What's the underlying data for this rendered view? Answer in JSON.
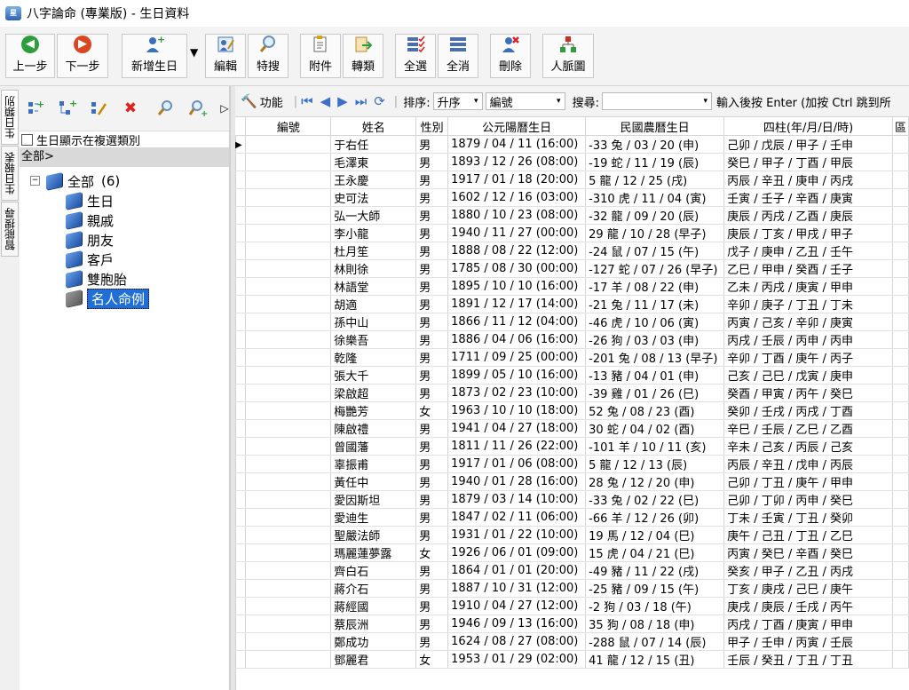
{
  "window": {
    "title": "八字論命 (專業版) - 生日資料",
    "icon_text": "星"
  },
  "toolbar": {
    "buttons": [
      {
        "label": "上一步",
        "icon": "back-arrow-icon"
      },
      {
        "label": "下一步",
        "icon": "forward-arrow-icon"
      },
      {
        "label": "新增生日",
        "icon": "add-user-icon"
      },
      {
        "label": "編輯",
        "icon": "edit-icon"
      },
      {
        "label": "特搜",
        "icon": "search-icon"
      },
      {
        "label": "附件",
        "icon": "attachment-icon"
      },
      {
        "label": "轉類",
        "icon": "transfer-icon"
      },
      {
        "label": "全選",
        "icon": "select-all-icon"
      },
      {
        "label": "全消",
        "icon": "deselect-all-icon"
      },
      {
        "label": "刪除",
        "icon": "delete-user-icon"
      },
      {
        "label": "人脈圖",
        "icon": "network-icon"
      }
    ]
  },
  "side_tabs": [
    "生日類別",
    "生日報表",
    "智能搜尋"
  ],
  "left_panel": {
    "checkbox_label": "生日顯示在複選類別",
    "path": "全部>",
    "tree": {
      "root": {
        "label": "全部",
        "count": "(6)"
      },
      "children": [
        "生日",
        "親戚",
        "朋友",
        "客戶",
        "雙胞胎",
        "名人命例"
      ]
    }
  },
  "grid_toolbar": {
    "function_label": "功能",
    "sort_label": "排序:",
    "sort_order": "升序",
    "sort_field": "編號",
    "search_label": "搜尋:",
    "search_value": "",
    "hint": "輸入後按 Enter (加按 Ctrl 跳到所"
  },
  "grid": {
    "columns": [
      "編號",
      "姓名",
      "性別",
      "公元陽曆生日",
      "民國農曆生日",
      "四柱(年/月/日/時)",
      "區"
    ],
    "rows": [
      [
        "",
        "于右任",
        "男",
        "1879 / 04 / 11 (16:00)",
        "-33 兔 / 03 / 20 (申)",
        "己卯 / 戊辰 / 甲子 / 壬申"
      ],
      [
        "",
        "毛澤東",
        "男",
        "1893 / 12 / 26 (08:00)",
        "-19 蛇 / 11 / 19 (辰)",
        "癸巳 / 甲子 / 丁酉 / 甲辰"
      ],
      [
        "",
        "王永慶",
        "男",
        "1917 / 01 / 18 (20:00)",
        "5 龍 / 12 / 25 (戌)",
        "丙辰 / 辛丑 / 庚申 / 丙戌"
      ],
      [
        "",
        "史可法",
        "男",
        "1602 / 12 / 16 (03:00)",
        "-310 虎 / 11 / 04 (寅)",
        "壬寅 / 壬子 / 辛酉 / 庚寅"
      ],
      [
        "",
        "弘一大師",
        "男",
        "1880 / 10 / 23 (08:00)",
        "-32 龍 / 09 / 20 (辰)",
        "庚辰 / 丙戌 / 乙酉 / 庚辰"
      ],
      [
        "",
        "李小龍",
        "男",
        "1940 / 11 / 27 (00:00)",
        "29 龍 / 10 / 28 (早子)",
        "庚辰 / 丁亥 / 甲戌 / 甲子"
      ],
      [
        "",
        "杜月笙",
        "男",
        "1888 / 08 / 22 (12:00)",
        "-24 鼠 / 07 / 15 (午)",
        "戊子 / 庚申 / 乙丑 / 壬午"
      ],
      [
        "",
        "林則徐",
        "男",
        "1785 / 08 / 30 (00:00)",
        "-127 蛇 / 07 / 26 (早子)",
        "乙巳 / 甲申 / 癸酉 / 壬子"
      ],
      [
        "",
        "林語堂",
        "男",
        "1895 / 10 / 10 (16:00)",
        "-17 羊 / 08 / 22 (申)",
        "乙未 / 丙戌 / 庚寅 / 甲申"
      ],
      [
        "",
        "胡適",
        "男",
        "1891 / 12 / 17 (14:00)",
        "-21 兔 / 11 / 17 (未)",
        "辛卯 / 庚子 / 丁丑 / 丁未"
      ],
      [
        "",
        "孫中山",
        "男",
        "1866 / 11 / 12 (04:00)",
        "-46 虎 / 10 / 06 (寅)",
        "丙寅 / 己亥 / 辛卯 / 庚寅"
      ],
      [
        "",
        "徐樂吾",
        "男",
        "1886 / 04 / 06 (16:00)",
        "-26 狗 / 03 / 03 (申)",
        "丙戌 / 壬辰 / 丙申 / 丙申"
      ],
      [
        "",
        "乾隆",
        "男",
        "1711 / 09 / 25 (00:00)",
        "-201 兔 / 08 / 13 (早子)",
        "辛卯 / 丁酉 / 庚午 / 丙子"
      ],
      [
        "",
        "張大千",
        "男",
        "1899 / 05 / 10 (16:00)",
        "-13 豬 / 04 / 01 (申)",
        "己亥 / 己巳 / 戊寅 / 庚申"
      ],
      [
        "",
        "梁啟超",
        "男",
        "1873 / 02 / 23 (10:00)",
        "-39 雞 / 01 / 26 (巳)",
        "癸酉 / 甲寅 / 丙午 / 癸巳"
      ],
      [
        "",
        "梅艷芳",
        "女",
        "1963 / 10 / 10 (18:00)",
        "52 兔 / 08 / 23 (酉)",
        "癸卯 / 壬戌 / 丙戌 / 丁酉"
      ],
      [
        "",
        "陳啟禮",
        "男",
        "1941 / 04 / 27 (18:00)",
        "30 蛇 / 04 / 02 (酉)",
        "辛巳 / 壬辰 / 乙巳 / 乙酉"
      ],
      [
        "",
        "曾國藩",
        "男",
        "1811 / 11 / 26 (22:00)",
        "-101 羊 / 10 / 11 (亥)",
        "辛未 / 己亥 / 丙辰 / 己亥"
      ],
      [
        "",
        "辜振甫",
        "男",
        "1917 / 01 / 06 (08:00)",
        "5 龍 / 12 / 13 (辰)",
        "丙辰 / 辛丑 / 戊申 / 丙辰"
      ],
      [
        "",
        "黃任中",
        "男",
        "1940 / 01 / 28 (16:00)",
        "28 兔 / 12 / 20 (申)",
        "己卯 / 丁丑 / 庚午 / 甲申"
      ],
      [
        "",
        "愛因斯坦",
        "男",
        "1879 / 03 / 14 (10:00)",
        "-33 兔 / 02 / 22 (巳)",
        "己卯 / 丁卯 / 丙申 / 癸巳"
      ],
      [
        "",
        "愛迪生",
        "男",
        "1847 / 02 / 11 (06:00)",
        "-66 羊 / 12 / 26 (卯)",
        "丁未 / 壬寅 / 丁丑 / 癸卯"
      ],
      [
        "",
        "聖嚴法師",
        "男",
        "1931 / 01 / 22 (10:00)",
        "19 馬 / 12 / 04 (巳)",
        "庚午 / 己丑 / 丁丑 / 乙巳"
      ],
      [
        "",
        "瑪麗蓮夢露",
        "女",
        "1926 / 06 / 01 (09:00)",
        "15 虎 / 04 / 21 (巳)",
        "丙寅 / 癸巳 / 辛酉 / 癸巳"
      ],
      [
        "",
        "齊白石",
        "男",
        "1864 / 01 / 01 (20:00)",
        "-49 豬 / 11 / 22 (戌)",
        "癸亥 / 甲子 / 乙丑 / 丙戌"
      ],
      [
        "",
        "蔣介石",
        "男",
        "1887 / 10 / 31 (12:00)",
        "-25 豬 / 09 / 15 (午)",
        "丁亥 / 庚戌 / 己巳 / 庚午"
      ],
      [
        "",
        "蔣經國",
        "男",
        "1910 / 04 / 27 (12:00)",
        "-2 狗 / 03 / 18 (午)",
        "庚戌 / 庚辰 / 壬戌 / 丙午"
      ],
      [
        "",
        "蔡辰洲",
        "男",
        "1946 / 09 / 13 (16:00)",
        "35 狗 / 08 / 18 (申)",
        "丙戌 / 丁酉 / 庚寅 / 甲申"
      ],
      [
        "",
        "鄭成功",
        "男",
        "1624 / 08 / 27 (08:00)",
        "-288 鼠 / 07 / 14 (辰)",
        "甲子 / 壬申 / 丙寅 / 壬辰"
      ],
      [
        "",
        "鄧麗君",
        "女",
        "1953 / 01 / 29 (02:00)",
        "41 龍 / 12 / 15 (丑)",
        "壬辰 / 癸丑 / 丁丑 / 丁丑"
      ]
    ]
  }
}
